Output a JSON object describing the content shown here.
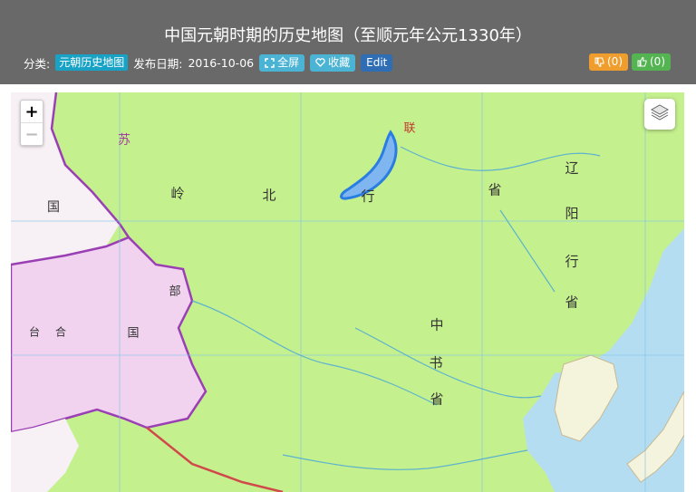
{
  "page": {
    "title": "中国元朝时期的历史地图（至顺元年公元1330年）",
    "category_label": "分类:",
    "category_tag": "元朝历史地图",
    "date_label": "发布日期:",
    "date_value": "2016-10-06",
    "fullscreen_label": "全屏",
    "favorite_label": "收藏",
    "edit_label": "Edit",
    "dislike_count": "(0)",
    "like_count": "(0)"
  },
  "map": {
    "zoom_in": "+",
    "zoom_out": "−",
    "layers_icon": "layers-icon",
    "colors": {
      "yuan_territory": "#c5f08e",
      "chagatai_khanate": "#f1d3f0",
      "sea": "#b4ddf2",
      "border_purple": "#9a3fb4",
      "border_red": "#d04a4a",
      "highlight_lake": "#2a7de1"
    },
    "labels": {
      "l1": "岭",
      "l2": "北",
      "l3": "行",
      "l4": "省",
      "l5": "辽",
      "l6": "阳",
      "l7": "行",
      "l8": "省",
      "l9": "中",
      "l10": "书",
      "l11": "省",
      "l12": "国",
      "l13": "联",
      "l14": "苏",
      "l15": "部",
      "l16": "国",
      "l17": "台",
      "l18": "合"
    }
  }
}
